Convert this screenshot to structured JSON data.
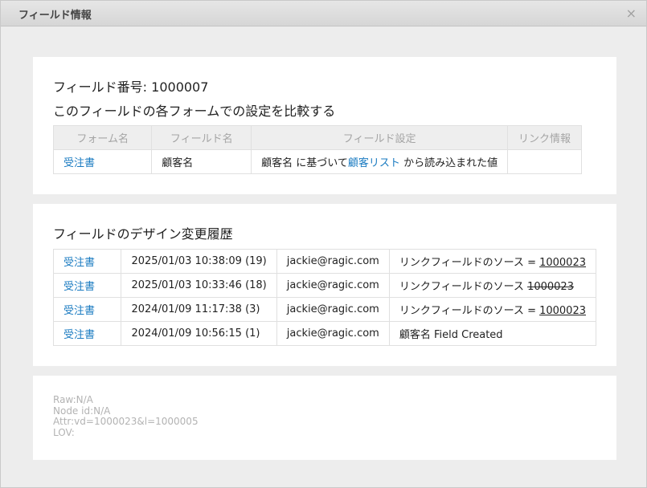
{
  "dialog": {
    "title": "フィールド情報",
    "close_glyph": "×"
  },
  "field_section": {
    "number_label": "フィールド番号: 1000007",
    "compare_heading": "このフィールドの各フォームでの設定を比較する",
    "columns": [
      "フォーム名",
      "フィールド名",
      "フィールド設定",
      "リンク情報"
    ],
    "rows": [
      {
        "form_name": "受注書",
        "field_name": "顧客名",
        "setting_prefix": "顧客名 に基づいて",
        "setting_link": "顧客リスト",
        "setting_suffix": " から読み込まれた値",
        "link_info": ""
      }
    ]
  },
  "history_section": {
    "heading": "フィールドのデザイン変更履歴",
    "rows": [
      {
        "form": "受注書",
        "datetime": "2025/01/03 10:38:09 (19)",
        "user": "jackie@ragic.com",
        "change_prefix": "リンクフィールドのソース = ",
        "change_value": "1000023",
        "style": "underline"
      },
      {
        "form": "受注書",
        "datetime": "2025/01/03 10:33:46 (18)",
        "user": "jackie@ragic.com",
        "change_prefix": "リンクフィールドのソース ",
        "change_value": "1000023",
        "style": "strike"
      },
      {
        "form": "受注書",
        "datetime": "2024/01/09 11:17:38 (3)",
        "user": "jackie@ragic.com",
        "change_prefix": "リンクフィールドのソース = ",
        "change_value": "1000023",
        "style": "underline"
      },
      {
        "form": "受注書",
        "datetime": "2024/01/09 10:56:15 (1)",
        "user": "jackie@ragic.com",
        "change_prefix": "顧客名 Field Created",
        "change_value": "",
        "style": "plain"
      }
    ]
  },
  "raw_info": {
    "raw": "Raw:N/A",
    "node_id": "Node id:N/A",
    "attr": "Attr:vd=1000023&l=1000005",
    "lov": "LOV:"
  },
  "colors": {
    "link": "#1a7bc1",
    "header_bg": "#eeeeee",
    "muted": "#b3b3b3"
  }
}
